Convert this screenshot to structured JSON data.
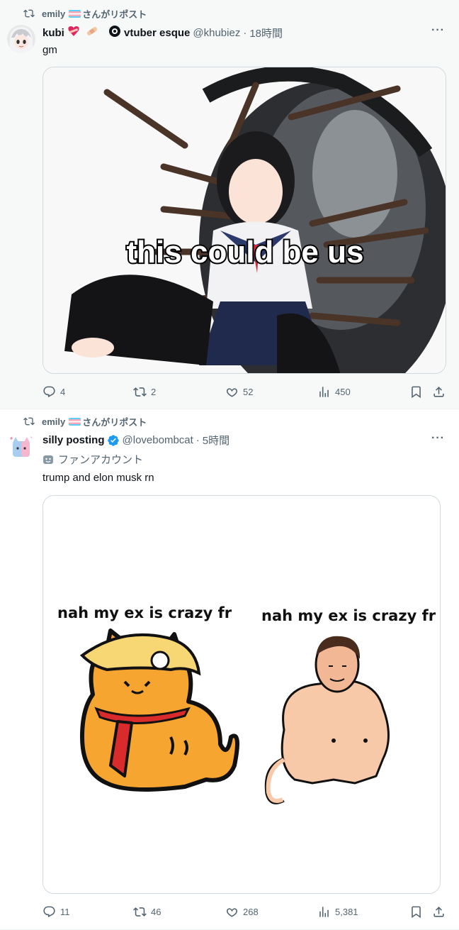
{
  "posts": [
    {
      "repost": {
        "user": "emily",
        "suffix": "さんがリポスト"
      },
      "author": {
        "name": "kubi",
        "emoji": "❤️ 🩹 🪬",
        "name2": "vtuber esque",
        "handle": "@khubiez",
        "time": "18時間"
      },
      "text": "gm",
      "media": {
        "caption": "this could be us"
      },
      "stats": {
        "replies": "4",
        "reposts": "2",
        "likes": "52",
        "views": "450"
      }
    },
    {
      "repost": {
        "user": "emily",
        "suffix": "さんがリポスト"
      },
      "author": {
        "name": "silly posting",
        "handle": "@lovebombcat",
        "time": "5時間",
        "label": "ファンアカウント"
      },
      "text": "trump and elon musk rn",
      "media": {
        "left_caption": "nah my ex is crazy fr",
        "right_caption": "nah my ex is crazy fr"
      },
      "stats": {
        "replies": "11",
        "reposts": "46",
        "likes": "268",
        "views": "5,381"
      }
    }
  ],
  "colors": {
    "muted": "#536471",
    "verified": "#1d9bf0",
    "border": "#cfd9de"
  },
  "icons": [
    "repost-icon",
    "reply-icon",
    "like-icon",
    "views-icon",
    "bookmark-icon",
    "share-icon",
    "more-icon",
    "verified-badge-icon"
  ]
}
